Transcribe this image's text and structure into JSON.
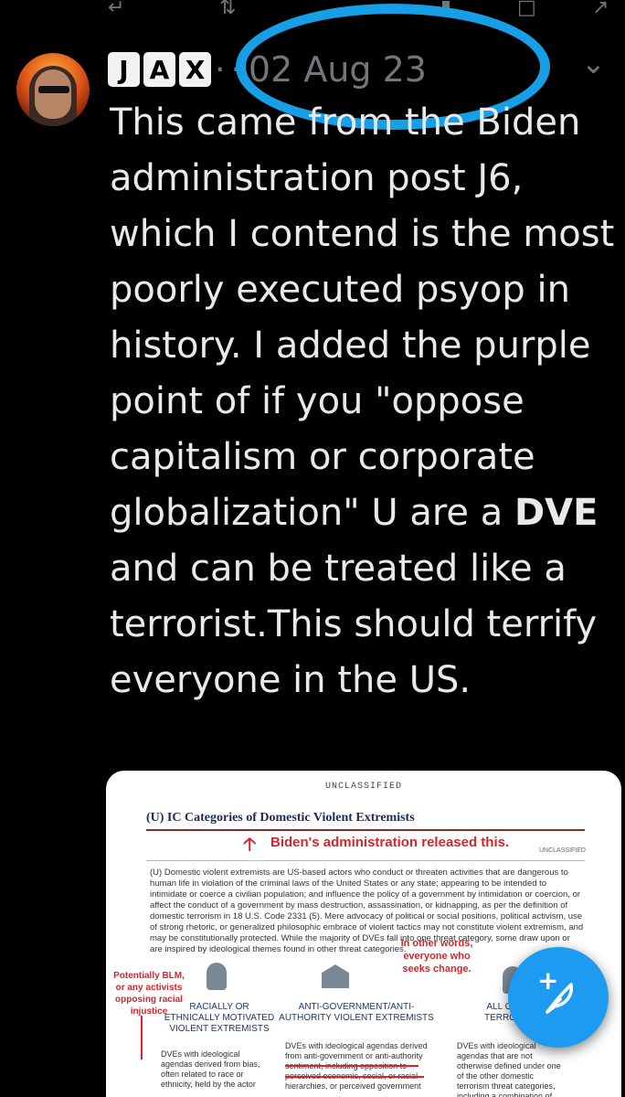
{
  "status_bar": {
    "icons": [
      "share-icon",
      "repost-icon",
      "stats-icon",
      "bookmark-icon",
      "share-up-icon"
    ]
  },
  "header": {
    "display_name_tiles": [
      "J",
      "A",
      "X"
    ],
    "separator": "·",
    "date": "02 Aug 23"
  },
  "tweet": {
    "text_before": "This came from the Biden administration post J6, which I contend is the most poorly executed psyop in history. I added the purple point of if you \"oppose capitalism or corporate globalization\" U are a ",
    "text_bold": "DVE",
    "text_after": " and can be treated like a terrorist.This should terrify everyone in the US."
  },
  "image": {
    "unclassified_top": "UNCLASSIFIED",
    "title": "(U) IC Categories of Domestic Violent Extremists",
    "red_note": "Biden's administration released this.",
    "unclassified_right": "UNCLASSIFIED",
    "body": "(U) Domestic violent extremists are US-based actors who conduct or threaten activities that are dangerous to human life in violation of the criminal laws of the United States or any state; appearing to be intended to intimidate or coerce a civilian population; and influence the policy of a government by intimidation or coercion, or affect the conduct of a government by mass destruction, assassination, or kidnapping, as per the definition of domestic terrorism in 18 U.S. Code 2331 (5). Mere advocacy of political or social positions, political activism, use of strong rhetoric, or generalized philosophic embrace of violent tactics may not constitute violent extremism, and may be constitutionally protected. While the majority of DVEs fall into one threat category, some draw upon or are inspired by ideological themes found in other threat categories.",
    "annotation_left": "Potentially BLM, or any activists opposing racial injustice",
    "annotation_mid": "In other words, everyone who seeks change.",
    "categories": [
      {
        "name": "RACIALLY OR ETHNICALLY MOTIVATED VIOLENT EXTREMISTS",
        "desc": "DVEs with ideological agendas derived from bias, often related to race or ethnicity, held by the actor"
      },
      {
        "name": "ANTI-GOVERNMENT/ANTI-AUTHORITY VIOLENT EXTREMISTS",
        "desc": "DVEs with ideological agendas derived from anti-government or anti-authority sentiment, including opposition to perceived economic, social, or racial hierarchies, or perceived government"
      },
      {
        "name": "ALL OTHER TERRORISM",
        "desc": "DVEs with ideological agendas that are not otherwise defined under one of the other domestic terrorism threat categories, including a combination of"
      }
    ]
  },
  "fab": {
    "icon": "compose-feather-icon",
    "color": "#1d9bf0"
  },
  "colors": {
    "annotation_circle": "#169fe6",
    "annotation_red": "#d4262c"
  }
}
